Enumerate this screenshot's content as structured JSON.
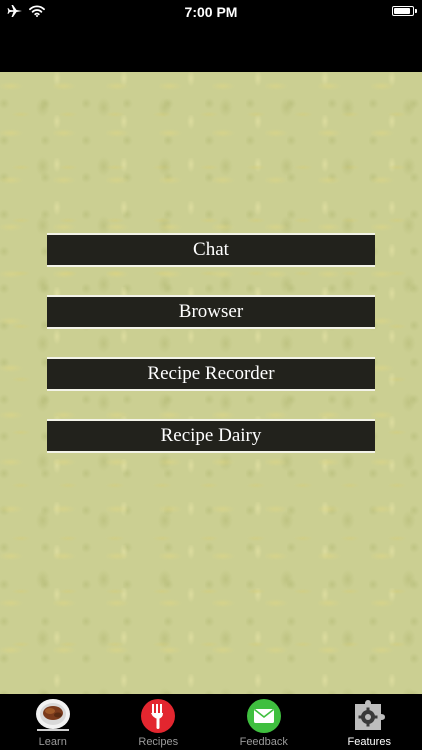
{
  "status_bar": {
    "time": "7:00 PM",
    "battery_level": 0.9
  },
  "menu": {
    "items": [
      {
        "label": "Chat"
      },
      {
        "label": "Browser"
      },
      {
        "label": "Recipe Recorder"
      },
      {
        "label": "Recipe Dairy"
      }
    ]
  },
  "tab_bar": {
    "active": "Features",
    "tabs": [
      {
        "label": "Learn",
        "icon": "plate-icon"
      },
      {
        "label": "Recipes",
        "icon": "fork-icon"
      },
      {
        "label": "Feedback",
        "icon": "envelope-icon"
      },
      {
        "label": "Features",
        "icon": "puzzle-gear-icon"
      }
    ]
  },
  "colors": {
    "background_texture": "#cbcf92",
    "button_fill": "#22221c",
    "button_border": "#f3f3e8",
    "bars": "#000000",
    "tab_active_label": "#ffffff",
    "tab_inactive_label": "#9a9a9a",
    "recipes_icon": "#e3262f",
    "feedback_icon": "#3fbf3f"
  }
}
